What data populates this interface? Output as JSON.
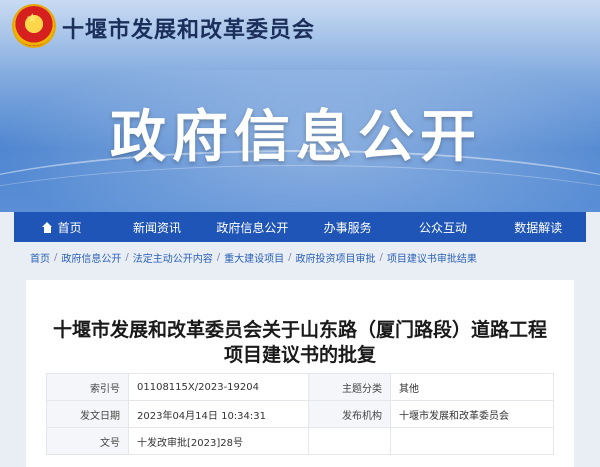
{
  "header": {
    "site_title": "十堰市发展和改革委员会",
    "hero_title": "政府信息公开",
    "emblem_icon": "national-emblem-icon"
  },
  "nav": {
    "items": [
      {
        "label": "首页",
        "icon": "home-icon"
      },
      {
        "label": "新闻资讯"
      },
      {
        "label": "政府信息公开"
      },
      {
        "label": "办事服务"
      },
      {
        "label": "公众互动"
      },
      {
        "label": "数据解读"
      }
    ]
  },
  "breadcrumb": {
    "items": [
      "首页",
      "政府信息公开",
      "法定主动公开内容",
      "重大建设项目",
      "政府投资项目审批",
      "项目建议书审批结果"
    ],
    "separator": "/"
  },
  "document": {
    "title_line1": "十堰市发展和改革委员会关于山东路（厦门路段）道路工程",
    "title_line2": "项目建议书的批复",
    "meta": {
      "index_label": "索引号",
      "index_value": "01108115X/2023-19204",
      "category_label": "主题分类",
      "category_value": "其他",
      "date_label": "发文日期",
      "date_value": "2023年04月14日 10:34:31",
      "org_label": "发布机构",
      "org_value": "十堰市发展和改革委员会",
      "docno_label": "文号",
      "docno_value": "十发改审批[2023]28号"
    }
  },
  "colors": {
    "nav_bg": "#1f55b6",
    "breadcrumb_link": "#2a5fb8",
    "banner_blue": "#4f86d0"
  }
}
